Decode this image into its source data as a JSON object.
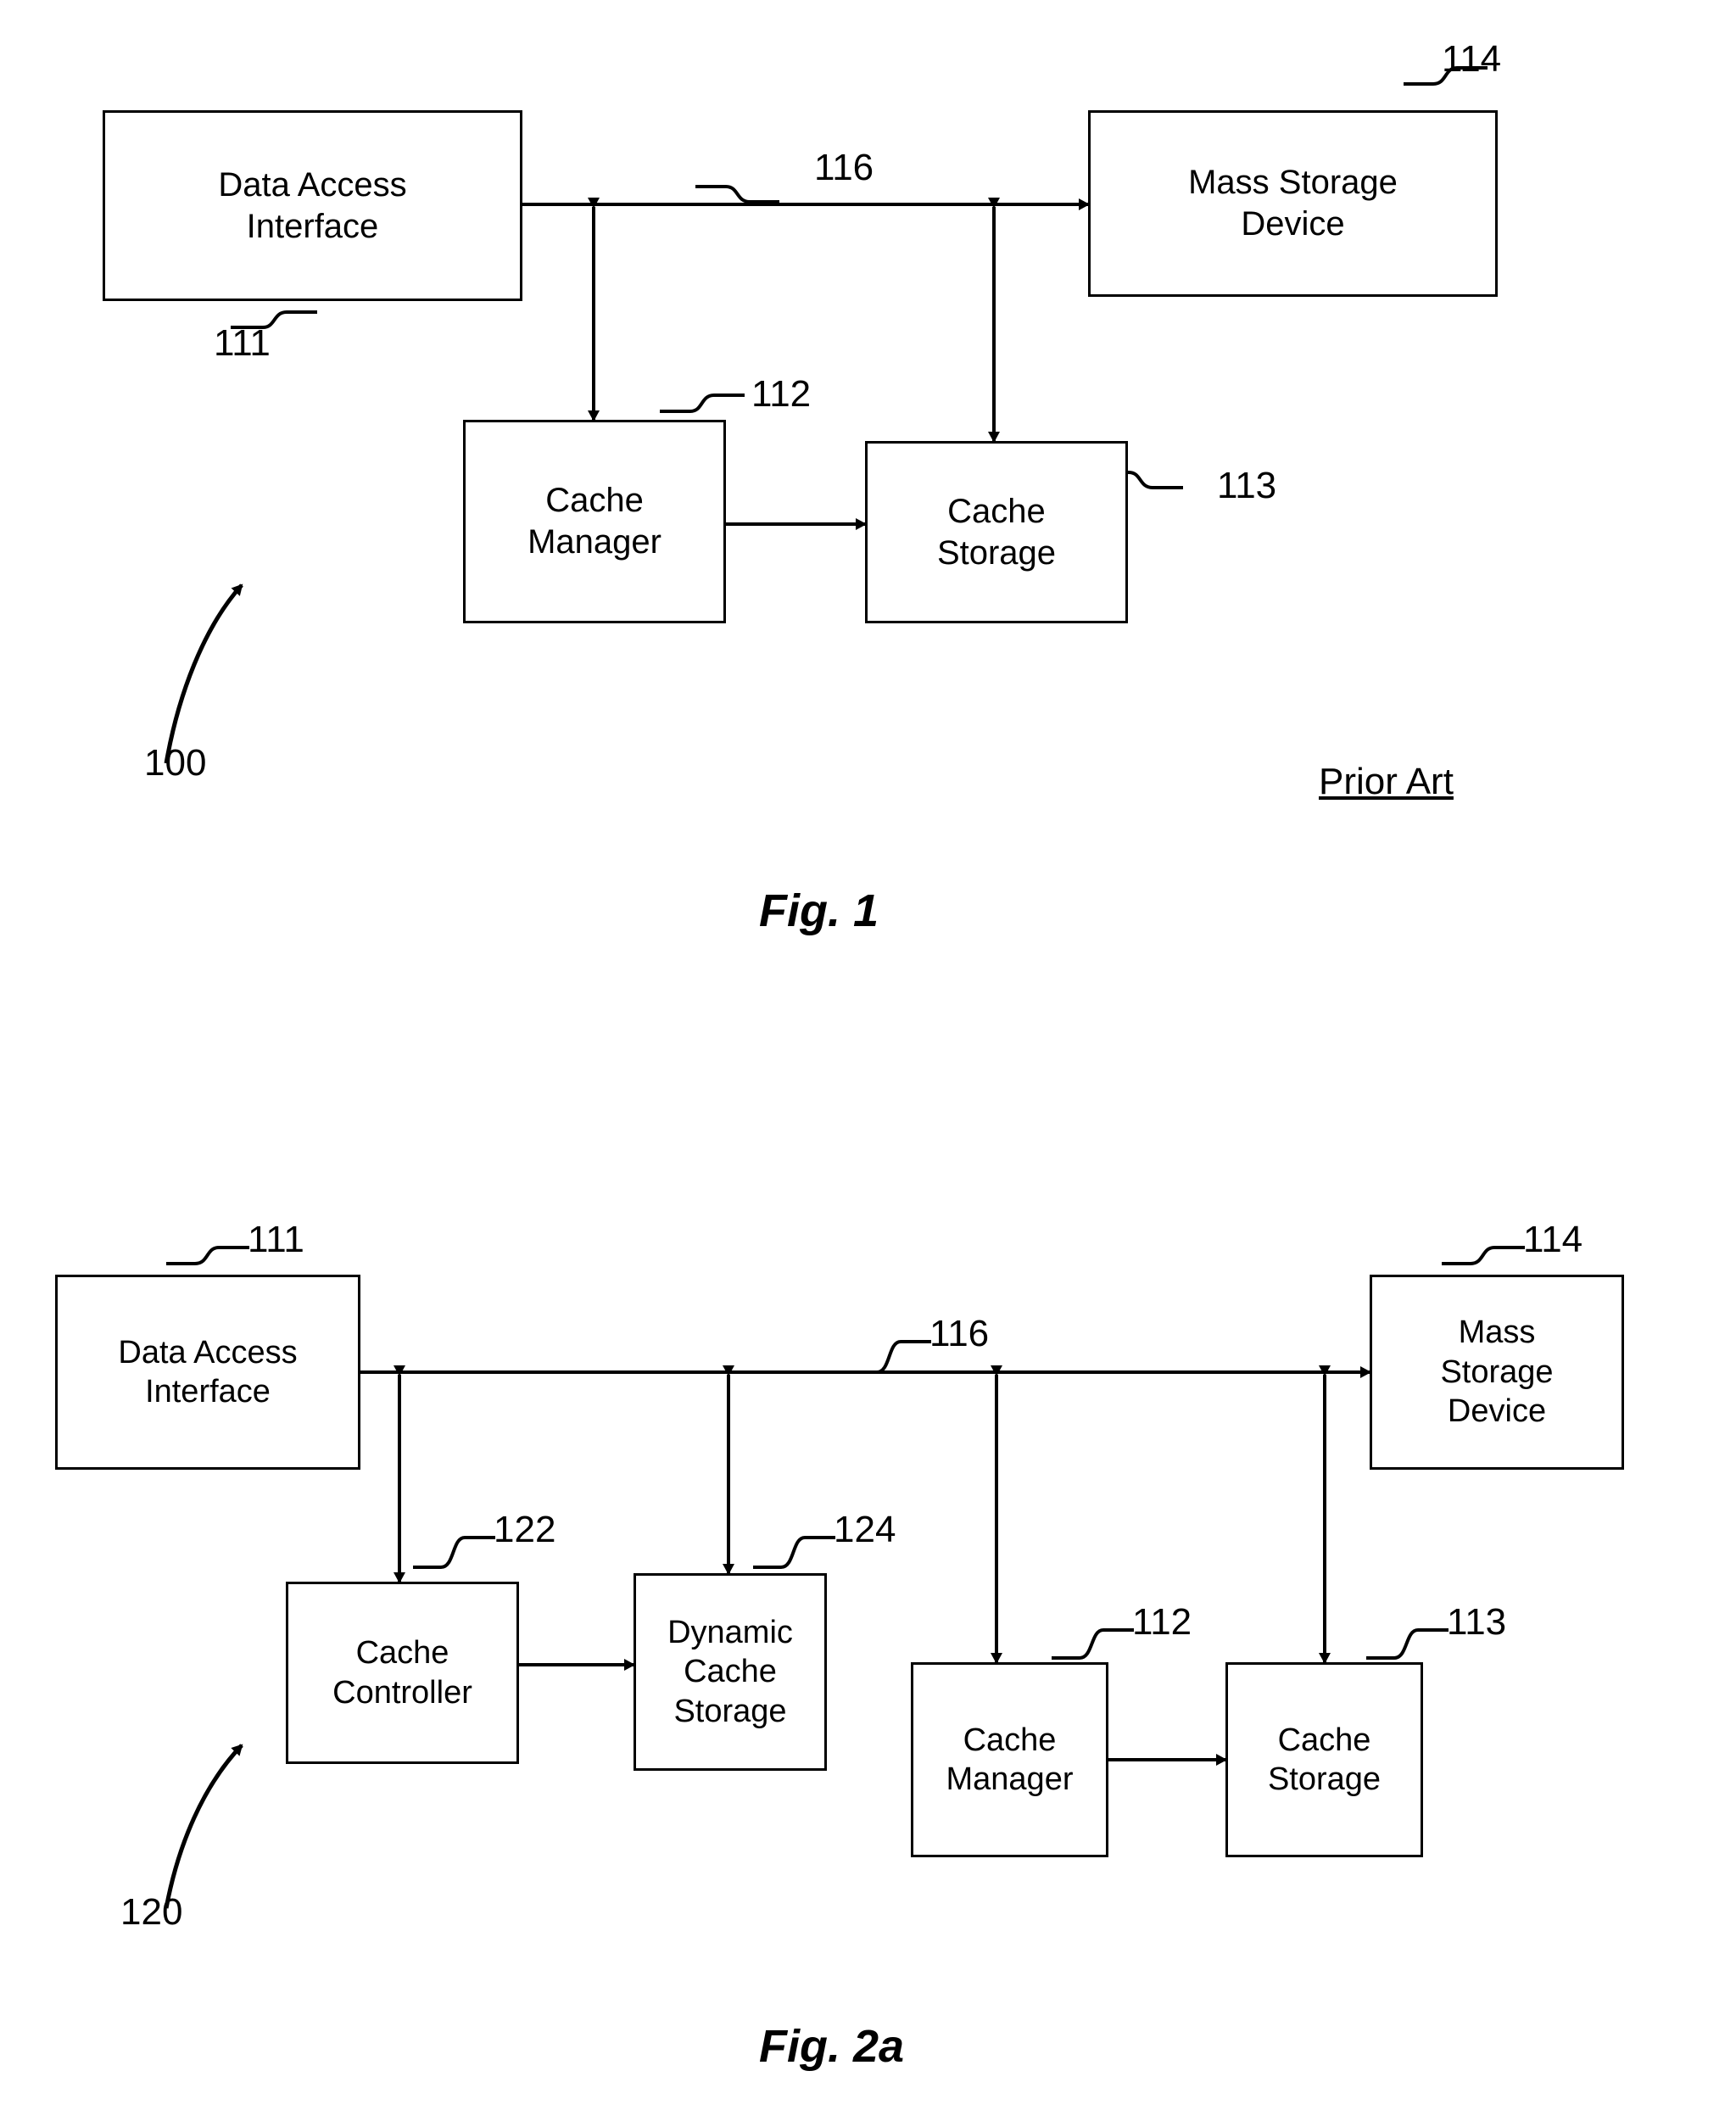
{
  "figures": [
    {
      "id": "fig1",
      "caption": "Fig. 1",
      "prior_art": "Prior Art",
      "diagram_ref": "100",
      "boxes": [
        {
          "id": "f1-dai",
          "label": "Data Access\nInterface",
          "ref": "111"
        },
        {
          "id": "f1-msd",
          "label": "Mass Storage\nDevice",
          "ref": "114"
        },
        {
          "id": "f1-cm",
          "label": "Cache\nManager",
          "ref": "112"
        },
        {
          "id": "f1-cs",
          "label": "Cache\nStorage",
          "ref": "113"
        }
      ],
      "bus_ref": "116"
    },
    {
      "id": "fig2a",
      "caption": "Fig. 2a",
      "diagram_ref": "120",
      "boxes": [
        {
          "id": "f2-dai",
          "label": "Data Access\nInterface",
          "ref": "111"
        },
        {
          "id": "f2-msd",
          "label": "Mass\nStorage\nDevice",
          "ref": "114"
        },
        {
          "id": "f2-cc",
          "label": "Cache\nController",
          "ref": "122"
        },
        {
          "id": "f2-dcs",
          "label": "Dynamic\nCache\nStorage",
          "ref": "124"
        },
        {
          "id": "f2-cm",
          "label": "Cache\nManager",
          "ref": "112"
        },
        {
          "id": "f2-cs",
          "label": "Cache\nStorage",
          "ref": "113"
        }
      ],
      "bus_ref": "116"
    }
  ]
}
